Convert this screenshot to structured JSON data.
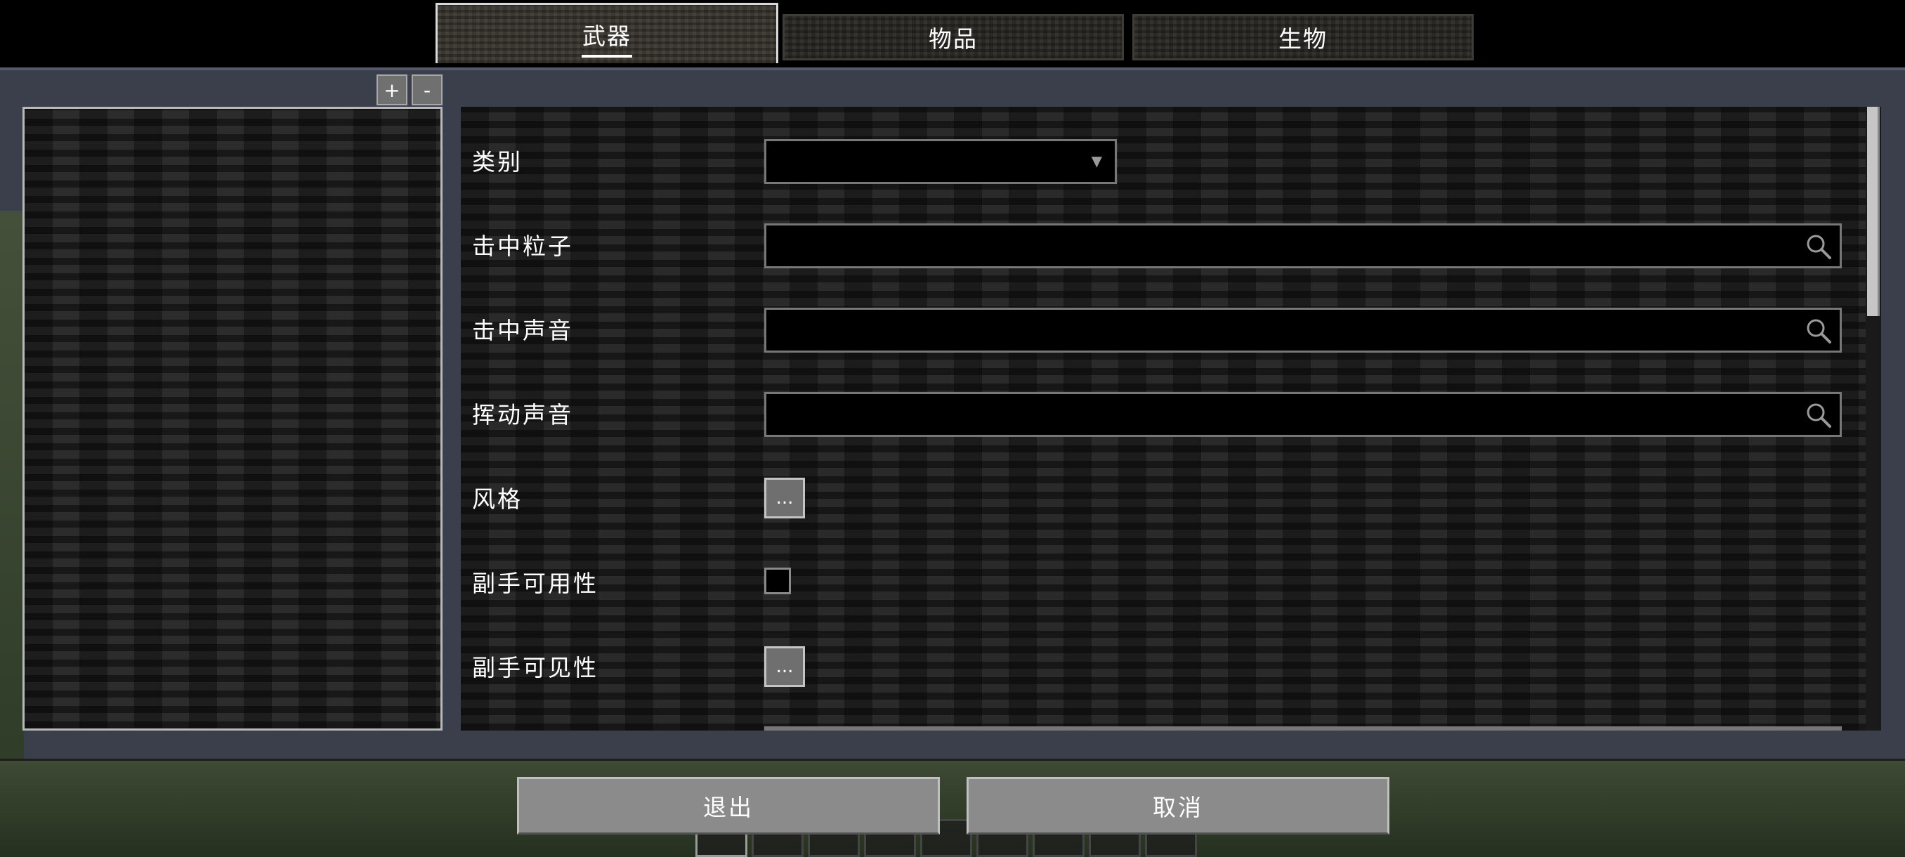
{
  "tabs": [
    {
      "label": "武器",
      "active": true
    },
    {
      "label": "物品",
      "active": false
    },
    {
      "label": "生物",
      "active": false
    }
  ],
  "list_controls": {
    "zoom_in": "+",
    "zoom_out": "-"
  },
  "form": {
    "category": {
      "label": "类别",
      "value": ""
    },
    "hit_particle": {
      "label": "击中粒子",
      "value": ""
    },
    "hit_sound": {
      "label": "击中声音",
      "value": ""
    },
    "swing_sound": {
      "label": "挥动声音",
      "value": ""
    },
    "style": {
      "label": "风格",
      "button": "..."
    },
    "offhand_usability": {
      "label": "副手可用性",
      "checked": false
    },
    "offhand_visibility": {
      "label": "副手可见性",
      "button": "..."
    }
  },
  "buttons": {
    "exit": "退出",
    "cancel": "取消"
  },
  "icons": {
    "dropdown": "chevron-down-icon",
    "search": "search-icon"
  },
  "colors": {
    "panel_bg": "#3b3f4b",
    "button_bg": "#8b8b8b",
    "field_bg": "#000000"
  }
}
